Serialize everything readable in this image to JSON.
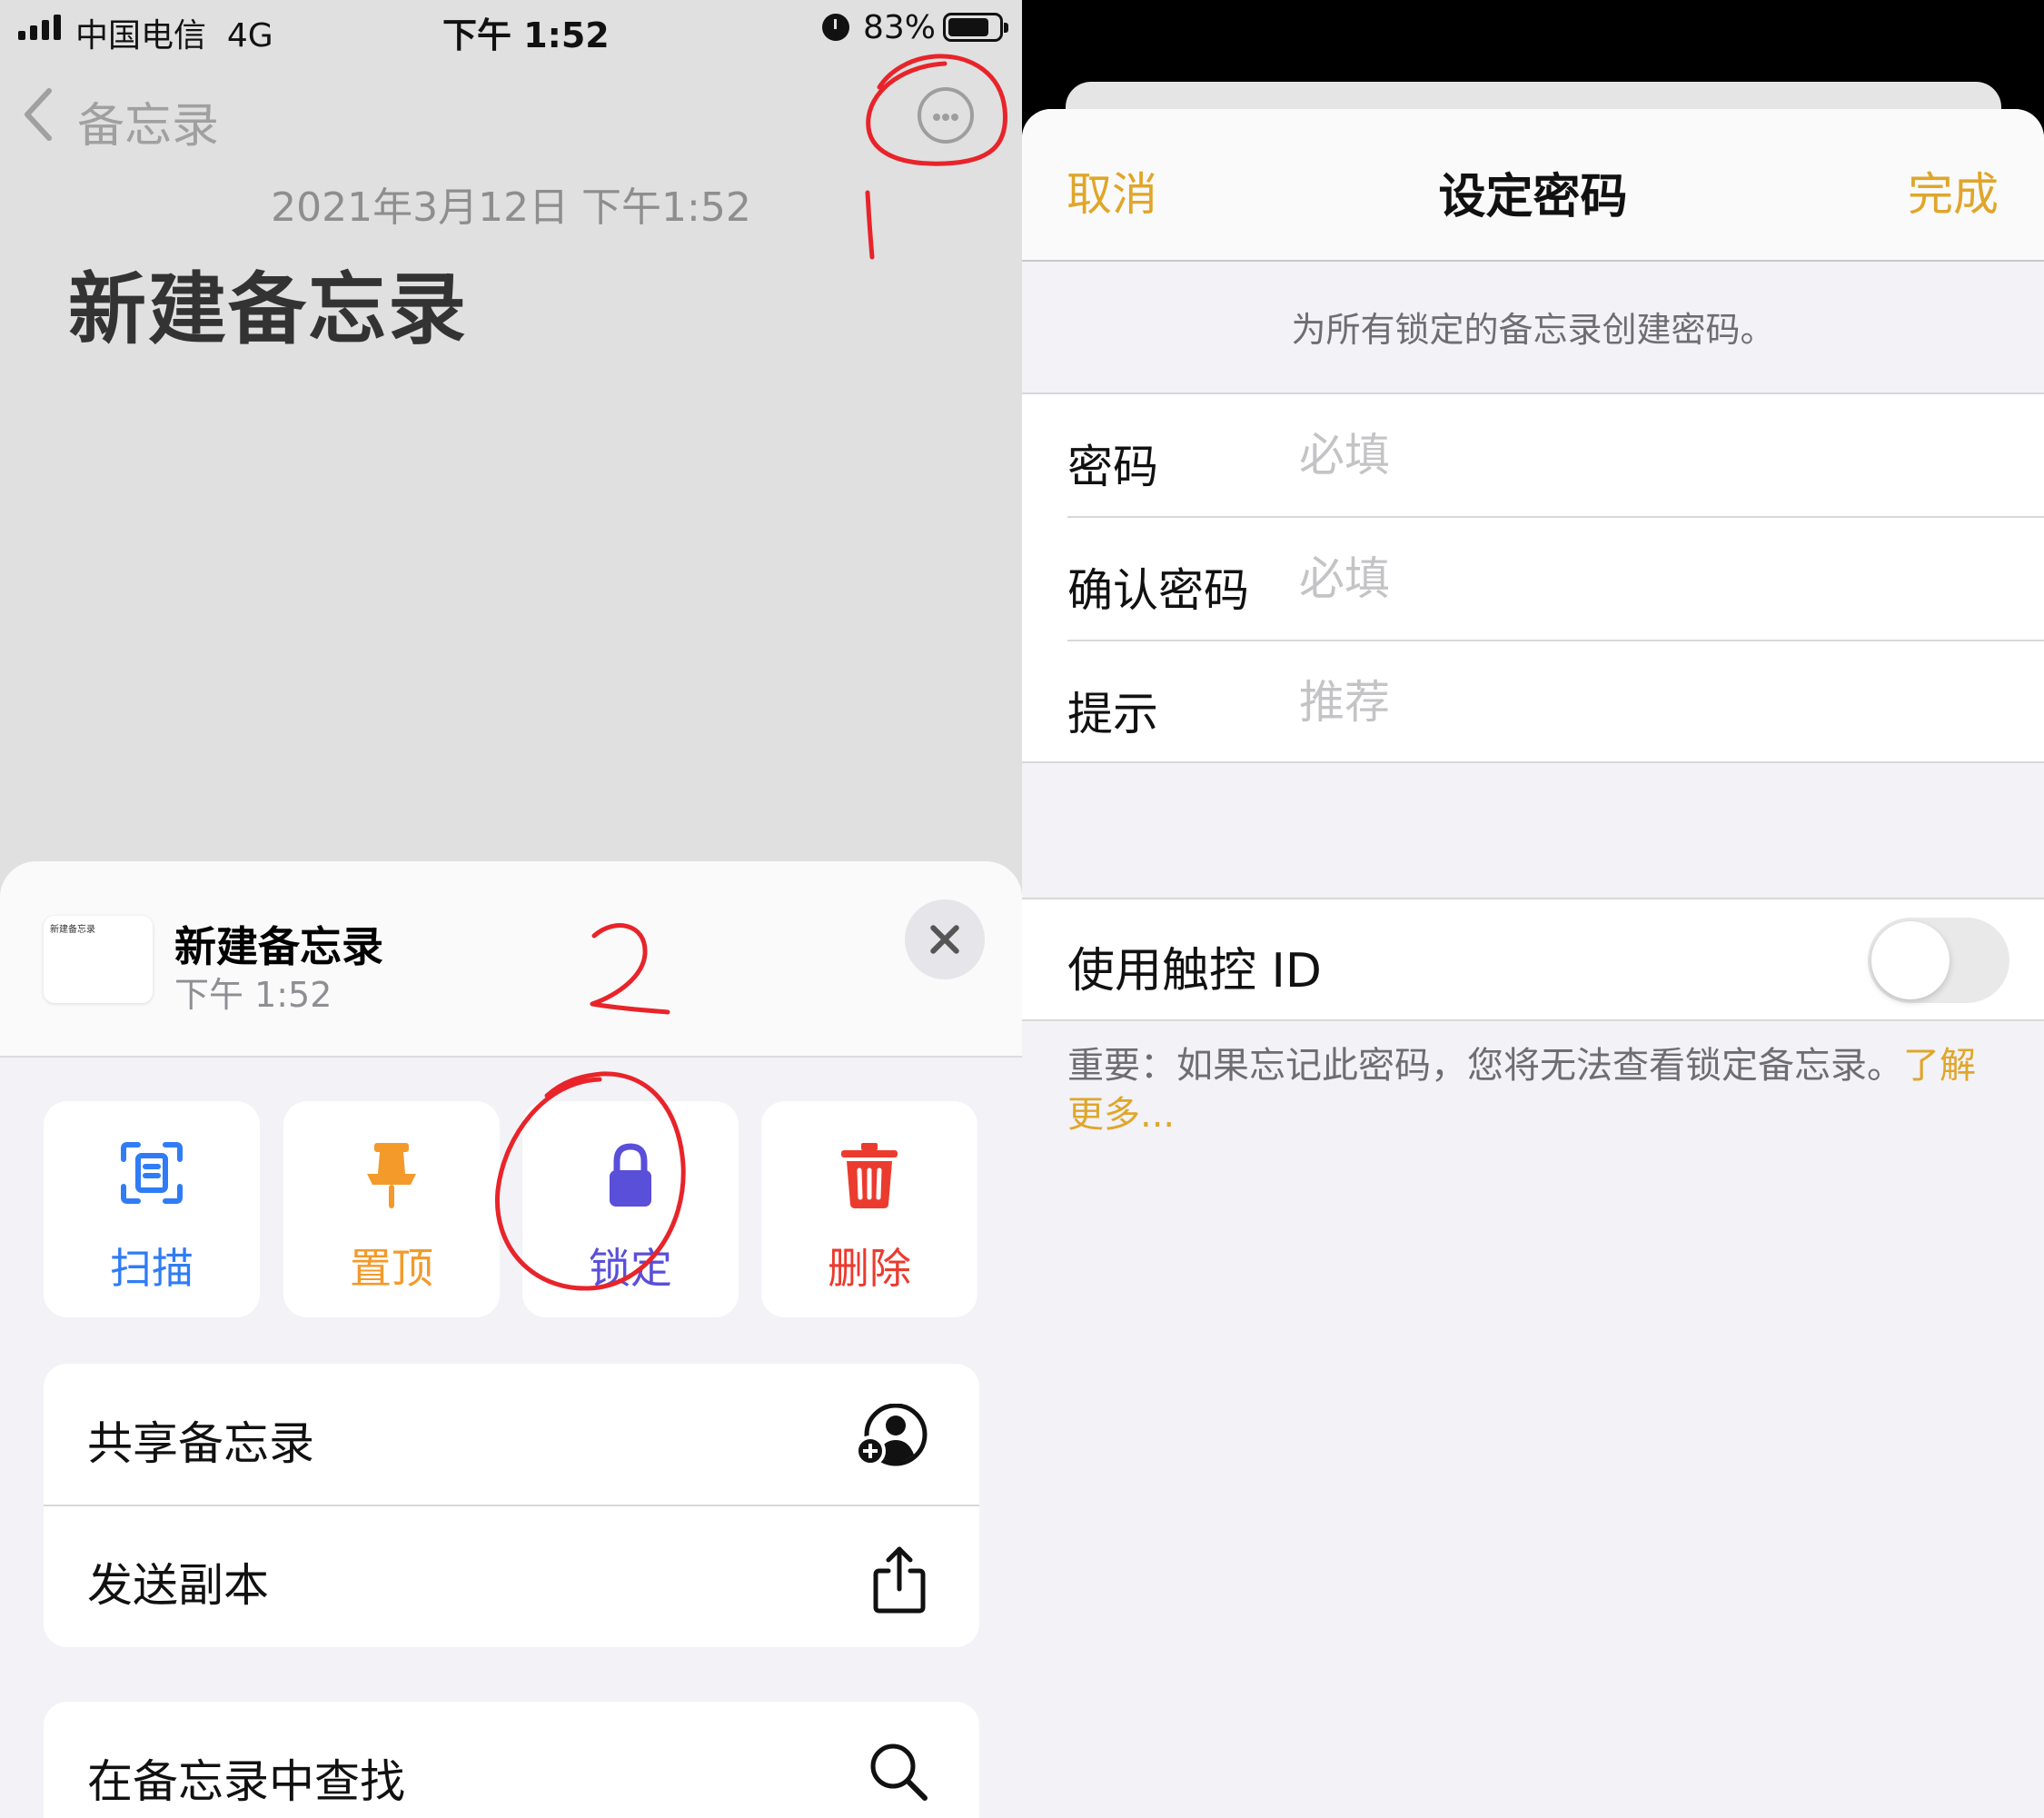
{
  "left": {
    "status_bar": {
      "carrier": "中国电信",
      "network": "4G",
      "time": "下午 1:52",
      "battery_percent": "83%",
      "battery_level": 0.83
    },
    "nav": {
      "back_label": "备忘录",
      "more_icon": "ellipsis-circle-icon"
    },
    "note": {
      "date": "2021年3月12日 下午1:52",
      "title": "新建备忘录"
    },
    "sheet": {
      "thumbnail_text": "新建备忘录",
      "title": "新建备忘录",
      "time": "下午 1:52",
      "close_icon": "xmark-icon",
      "actions": [
        {
          "label": "扫描",
          "icon": "scan-document-icon",
          "color": "#2f7cf6"
        },
        {
          "label": "置顶",
          "icon": "pin-icon",
          "color": "#f39a2b"
        },
        {
          "label": "锁定",
          "icon": "lock-icon",
          "color": "#5a4fd8"
        },
        {
          "label": "删除",
          "icon": "trash-icon",
          "color": "#eb3b2f"
        }
      ],
      "list_group_1": [
        {
          "label": "共享备忘录",
          "icon": "person-add-icon"
        },
        {
          "label": "发送副本",
          "icon": "share-icon"
        }
      ],
      "list_group_2": [
        {
          "label": "在备忘录中查找",
          "icon": "magnifier-icon"
        }
      ]
    },
    "annotations": {
      "step_1": "1",
      "step_2": "2",
      "color": "#e8242a"
    }
  },
  "right": {
    "nav": {
      "cancel": "取消",
      "title": "设定密码",
      "done": "完成"
    },
    "description": "为所有锁定的备忘录创建密码。",
    "form": [
      {
        "label": "密码",
        "placeholder": "必填",
        "value": ""
      },
      {
        "label": "确认密码",
        "placeholder": "必填",
        "value": ""
      },
      {
        "label": "提示",
        "placeholder": "推荐",
        "value": ""
      }
    ],
    "touch_id": {
      "label": "使用触控 ID",
      "enabled": false
    },
    "footer": {
      "text": "重要：如果忘记此密码，您将无法查看锁定备忘录。",
      "link": "了解更多..."
    }
  },
  "colors": {
    "accent_yellow": "#e0a62a",
    "scan_blue": "#2f7cf6",
    "pin_orange": "#f39a2b",
    "lock_purple": "#5a4fd8",
    "delete_red": "#eb3b2f"
  }
}
